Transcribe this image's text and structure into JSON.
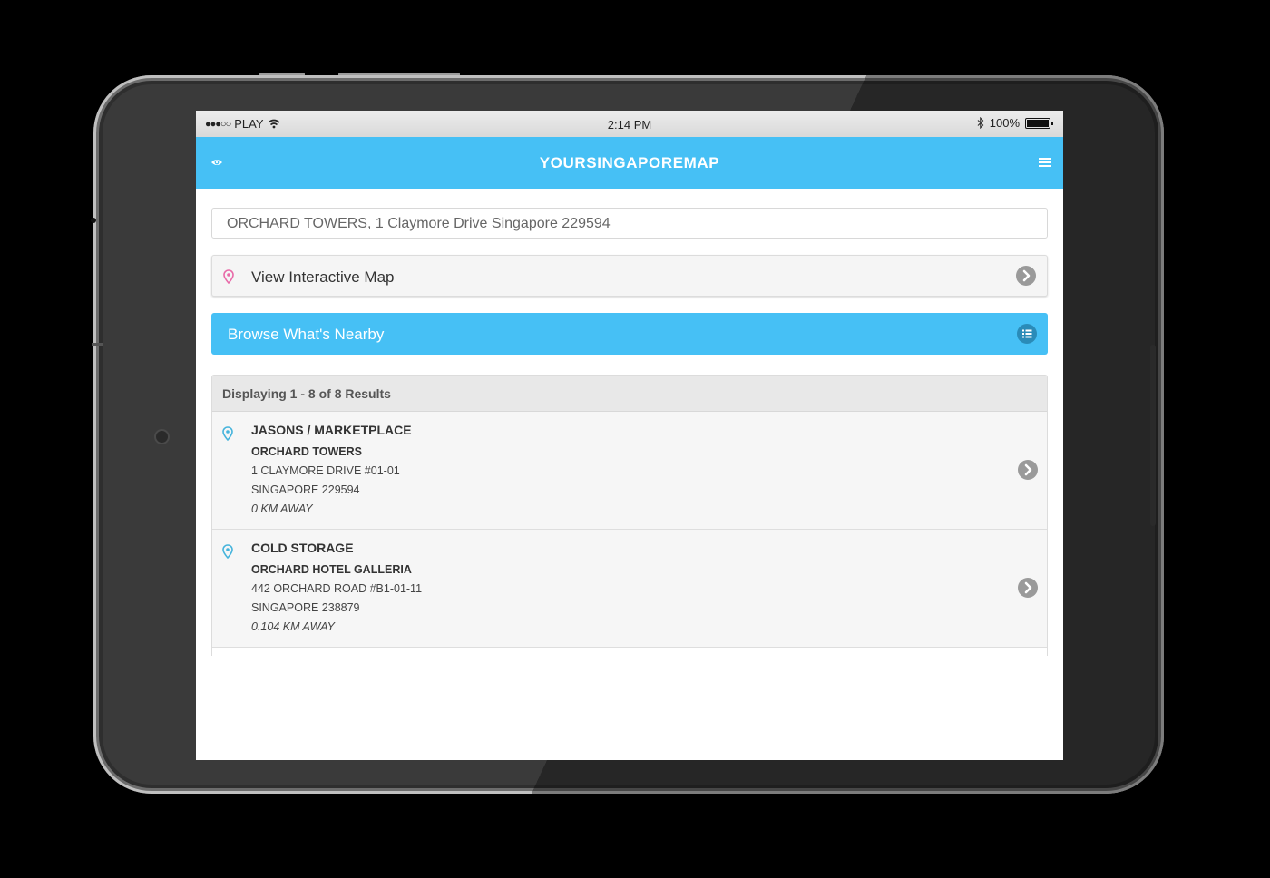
{
  "status_bar": {
    "signal": "●●●○○",
    "carrier": "PLAY",
    "time": "2:14 PM",
    "battery": "100%"
  },
  "header": {
    "title": "YOURSINGAPOREMAP",
    "left_icon": "eye-icon",
    "right_icon": "hamburger-menu-icon"
  },
  "address": {
    "value": "ORCHARD TOWERS, 1 Claymore Drive Singapore 229594"
  },
  "map_button": {
    "label": "View Interactive Map",
    "icon": "map-pin-icon"
  },
  "nearby_button": {
    "label": "Browse What's Nearby",
    "icon": "list-icon"
  },
  "results": {
    "summary": "Displaying 1 - 8 of 8 Results",
    "items": [
      {
        "name": "JASONS / MARKETPLACE",
        "place": "ORCHARD TOWERS",
        "address1": "1 CLAYMORE DRIVE #01-01",
        "address2": "SINGAPORE 229594",
        "distance": "0 KM AWAY"
      },
      {
        "name": "COLD STORAGE",
        "place": "ORCHARD HOTEL GALLERIA",
        "address1": "442 ORCHARD ROAD #B1-01-11",
        "address2": "SINGAPORE 238879",
        "distance": "0.104 KM AWAY"
      }
    ]
  },
  "colors": {
    "brand": "#46c0f5",
    "pin_pink": "#e86aa8",
    "pin_blue": "#46b4dc"
  }
}
